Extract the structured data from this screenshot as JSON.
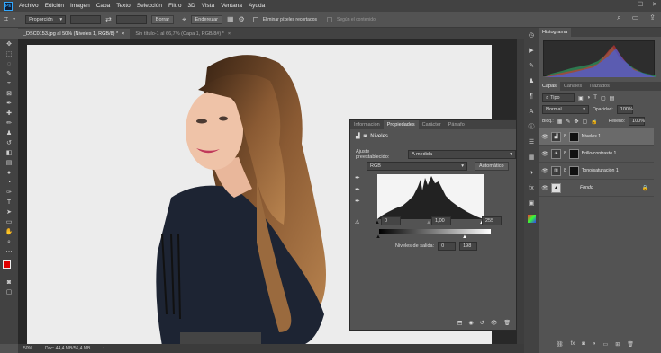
{
  "app": {
    "logo": "Ps"
  },
  "menu": [
    "Archivo",
    "Edición",
    "Imagen",
    "Capa",
    "Texto",
    "Selección",
    "Filtro",
    "3D",
    "Vista",
    "Ventana",
    "Ayuda"
  ],
  "options": {
    "style_value": "Proporción",
    "delete_label": "Borrar",
    "straighten_label": "Enderezar",
    "delete_cropped": "Eliminar píxeles recortados",
    "content_aware": "Según el contenido"
  },
  "tabs": [
    {
      "label": "_DSC0153.jpg al 50% (Niveles 1, RGB/8) *",
      "close": "×"
    },
    {
      "label": "Sin título-1 al 66,7% (Capa 1, RGB/8#) *",
      "close": "×"
    }
  ],
  "status": {
    "zoom": "50%",
    "doc": "Doc: 44,4 MB/56,4 MB"
  },
  "histogram_panel": {
    "title": "Histograma"
  },
  "layers_panel": {
    "tabs": [
      "Capas",
      "Canales",
      "Trazados"
    ],
    "kind_filter": "Tipo",
    "blend_mode": "Normal",
    "opacity_label": "Opacidad:",
    "opacity_value": "100%",
    "lock_label": "Bloq.:",
    "fill_label": "Relleno:",
    "fill_value": "100%",
    "layers": [
      {
        "name": "Niveles 1",
        "selected": true
      },
      {
        "name": "Brillo/contraste 1",
        "selected": false
      },
      {
        "name": "Tono/saturación 1",
        "selected": false
      },
      {
        "name": "Fondo",
        "selected": false
      }
    ]
  },
  "properties": {
    "tabs": [
      "Información",
      "Propiedades",
      "Carácter",
      "Párrafo"
    ],
    "adjustment_title": "Niveles",
    "preset_label": "Ajuste preestablecido:",
    "preset_value": "A medida",
    "channel": "RGB",
    "auto_label": "Automático",
    "input_black": "0",
    "input_gamma": "1,00",
    "input_white": "255",
    "output_label": "Niveles de salida:",
    "output_black": "0",
    "output_white": "198"
  },
  "colors": {
    "accent": "#31a8ff",
    "panel": "#535353",
    "dark": "#424242",
    "foreground": "#e00000",
    "background": "#ffffff"
  }
}
